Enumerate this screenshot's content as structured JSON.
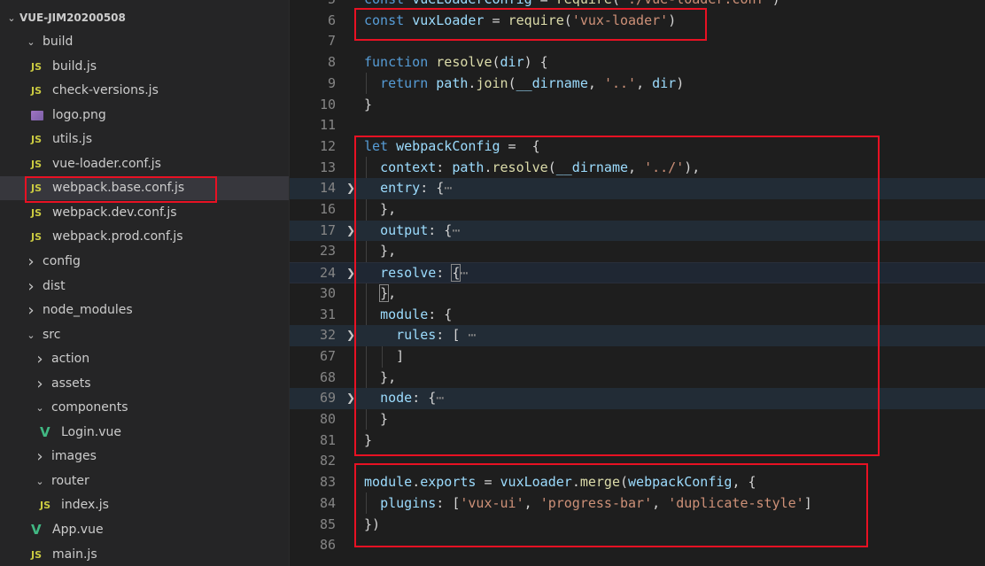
{
  "explorer": {
    "root_label": "VUE-JIM20200508",
    "items": [
      {
        "label": "build",
        "kind": "folder",
        "open": true,
        "depth": 1
      },
      {
        "label": "build.js",
        "kind": "js",
        "depth": 2
      },
      {
        "label": "check-versions.js",
        "kind": "js",
        "depth": 2
      },
      {
        "label": "logo.png",
        "kind": "img",
        "depth": 2
      },
      {
        "label": "utils.js",
        "kind": "js",
        "depth": 2
      },
      {
        "label": "vue-loader.conf.js",
        "kind": "js",
        "depth": 2
      },
      {
        "label": "webpack.base.conf.js",
        "kind": "js",
        "depth": 2,
        "selected": true
      },
      {
        "label": "webpack.dev.conf.js",
        "kind": "js",
        "depth": 2
      },
      {
        "label": "webpack.prod.conf.js",
        "kind": "js",
        "depth": 2
      },
      {
        "label": "config",
        "kind": "folder",
        "open": false,
        "depth": 1
      },
      {
        "label": "dist",
        "kind": "folder",
        "open": false,
        "depth": 1
      },
      {
        "label": "node_modules",
        "kind": "folder",
        "open": false,
        "depth": 1
      },
      {
        "label": "src",
        "kind": "folder",
        "open": true,
        "depth": 1
      },
      {
        "label": "action",
        "kind": "folder",
        "open": false,
        "depth": 2
      },
      {
        "label": "assets",
        "kind": "folder",
        "open": false,
        "depth": 2
      },
      {
        "label": "components",
        "kind": "folder",
        "open": true,
        "depth": 2
      },
      {
        "label": "Login.vue",
        "kind": "vue",
        "depth": 3
      },
      {
        "label": "images",
        "kind": "folder",
        "open": false,
        "depth": 2
      },
      {
        "label": "router",
        "kind": "folder",
        "open": true,
        "depth": 2
      },
      {
        "label": "index.js",
        "kind": "js",
        "depth": 3
      },
      {
        "label": "App.vue",
        "kind": "vue",
        "depth": 2
      },
      {
        "label": "main.js",
        "kind": "js",
        "depth": 2
      }
    ]
  },
  "icons": {
    "chevron_right": "chevron-right-icon",
    "chevron_down": "chevron-down-icon",
    "js_file": "js-file-icon",
    "vue_file": "vue-file-icon",
    "image_file": "image-file-icon",
    "js_glyph": "JS",
    "vue_glyph": "V"
  },
  "editor": {
    "lines": [
      {
        "num": "5",
        "tokens": [
          [
            "k",
            "const "
          ],
          [
            "v",
            "vueLoaderConfig"
          ],
          [
            "p",
            " = "
          ],
          [
            "f",
            "require"
          ],
          [
            "p",
            "("
          ],
          [
            "s",
            "'./vue-loader.conf'"
          ],
          [
            "p",
            ")"
          ]
        ]
      },
      {
        "num": "6",
        "tokens": [
          [
            "k",
            "const "
          ],
          [
            "v",
            "vuxLoader"
          ],
          [
            "p",
            " = "
          ],
          [
            "f",
            "require"
          ],
          [
            "p",
            "("
          ],
          [
            "s",
            "'vux-loader'"
          ],
          [
            "p",
            ")"
          ]
        ]
      },
      {
        "num": "7",
        "tokens": []
      },
      {
        "num": "8",
        "tokens": [
          [
            "k",
            "function "
          ],
          [
            "f",
            "resolve"
          ],
          [
            "p",
            "("
          ],
          [
            "v",
            "dir"
          ],
          [
            "p",
            ") {"
          ]
        ]
      },
      {
        "num": "9",
        "tokens": [
          [
            "p",
            "  "
          ],
          [
            "k",
            "return "
          ],
          [
            "v",
            "path"
          ],
          [
            "p",
            "."
          ],
          [
            "f",
            "join"
          ],
          [
            "p",
            "("
          ],
          [
            "v",
            "__dirname"
          ],
          [
            "p",
            ", "
          ],
          [
            "s",
            "'..'"
          ],
          [
            "p",
            ", "
          ],
          [
            "v",
            "dir"
          ],
          [
            "p",
            ")"
          ]
        ]
      },
      {
        "num": "10",
        "tokens": [
          [
            "p",
            "}"
          ]
        ]
      },
      {
        "num": "11",
        "tokens": []
      },
      {
        "num": "12",
        "tokens": [
          [
            "k",
            "let "
          ],
          [
            "v",
            "webpackConfig"
          ],
          [
            "p",
            " =  {"
          ]
        ]
      },
      {
        "num": "13",
        "tokens": [
          [
            "p",
            "  "
          ],
          [
            "v",
            "context"
          ],
          [
            "p",
            ": "
          ],
          [
            "v",
            "path"
          ],
          [
            "p",
            "."
          ],
          [
            "f",
            "resolve"
          ],
          [
            "p",
            "("
          ],
          [
            "v",
            "__dirname"
          ],
          [
            "p",
            ", "
          ],
          [
            "s",
            "'../'"
          ],
          [
            "p",
            "),"
          ]
        ]
      },
      {
        "num": "14",
        "folded": true,
        "tokens": [
          [
            "p",
            "  "
          ],
          [
            "v",
            "entry"
          ],
          [
            "p",
            ": {"
          ],
          [
            "ell",
            "⋯"
          ]
        ]
      },
      {
        "num": "16",
        "tokens": [
          [
            "p",
            "  },"
          ]
        ]
      },
      {
        "num": "17",
        "folded": true,
        "tokens": [
          [
            "p",
            "  "
          ],
          [
            "v",
            "output"
          ],
          [
            "p",
            ": {"
          ],
          [
            "ell",
            "⋯"
          ]
        ]
      },
      {
        "num": "23",
        "tokens": [
          [
            "p",
            "  },"
          ]
        ]
      },
      {
        "num": "24",
        "folded": true,
        "cursor": true,
        "tokens": [
          [
            "p",
            "  "
          ],
          [
            "v",
            "resolve"
          ],
          [
            "p",
            ": "
          ],
          [
            "box",
            "{"
          ],
          [
            "ell",
            "⋯"
          ]
        ]
      },
      {
        "num": "30",
        "tokens": [
          [
            "p",
            "  "
          ],
          [
            "box",
            "}"
          ],
          [
            "p",
            ","
          ]
        ]
      },
      {
        "num": "31",
        "tokens": [
          [
            "p",
            "  "
          ],
          [
            "v",
            "module"
          ],
          [
            "p",
            ": {"
          ]
        ]
      },
      {
        "num": "32",
        "folded": true,
        "tokens": [
          [
            "p",
            "    "
          ],
          [
            "v",
            "rules"
          ],
          [
            "p",
            ": [ "
          ],
          [
            "ell",
            "⋯"
          ]
        ]
      },
      {
        "num": "67",
        "tokens": [
          [
            "p",
            "    ]"
          ]
        ]
      },
      {
        "num": "68",
        "tokens": [
          [
            "p",
            "  },"
          ]
        ]
      },
      {
        "num": "69",
        "folded": true,
        "tokens": [
          [
            "p",
            "  "
          ],
          [
            "v",
            "node"
          ],
          [
            "p",
            ": {"
          ],
          [
            "ell",
            "⋯"
          ]
        ]
      },
      {
        "num": "80",
        "tokens": [
          [
            "p",
            "  }"
          ]
        ]
      },
      {
        "num": "81",
        "tokens": [
          [
            "p",
            "}"
          ]
        ]
      },
      {
        "num": "82",
        "tokens": []
      },
      {
        "num": "83",
        "tokens": [
          [
            "v",
            "module"
          ],
          [
            "p",
            "."
          ],
          [
            "v",
            "exports"
          ],
          [
            "p",
            " = "
          ],
          [
            "v",
            "vuxLoader"
          ],
          [
            "p",
            "."
          ],
          [
            "f",
            "merge"
          ],
          [
            "p",
            "("
          ],
          [
            "v",
            "webpackConfig"
          ],
          [
            "p",
            ", {"
          ]
        ]
      },
      {
        "num": "84",
        "tokens": [
          [
            "p",
            "  "
          ],
          [
            "v",
            "plugins"
          ],
          [
            "p",
            ": ["
          ],
          [
            "s",
            "'vux-ui'"
          ],
          [
            "p",
            ", "
          ],
          [
            "s",
            "'progress-bar'"
          ],
          [
            "p",
            ", "
          ],
          [
            "s",
            "'duplicate-style'"
          ],
          [
            "p",
            "]"
          ]
        ]
      },
      {
        "num": "85",
        "tokens": [
          [
            "p",
            "})"
          ]
        ]
      },
      {
        "num": "86",
        "tokens": []
      }
    ]
  },
  "colors": {
    "annotation_red": "#e81123",
    "sidebar_bg": "#252526",
    "editor_bg": "#1e1e1e",
    "keyword": "#569cd6",
    "function": "#dcdcaa",
    "variable": "#9cdcfe",
    "string": "#ce9178"
  }
}
